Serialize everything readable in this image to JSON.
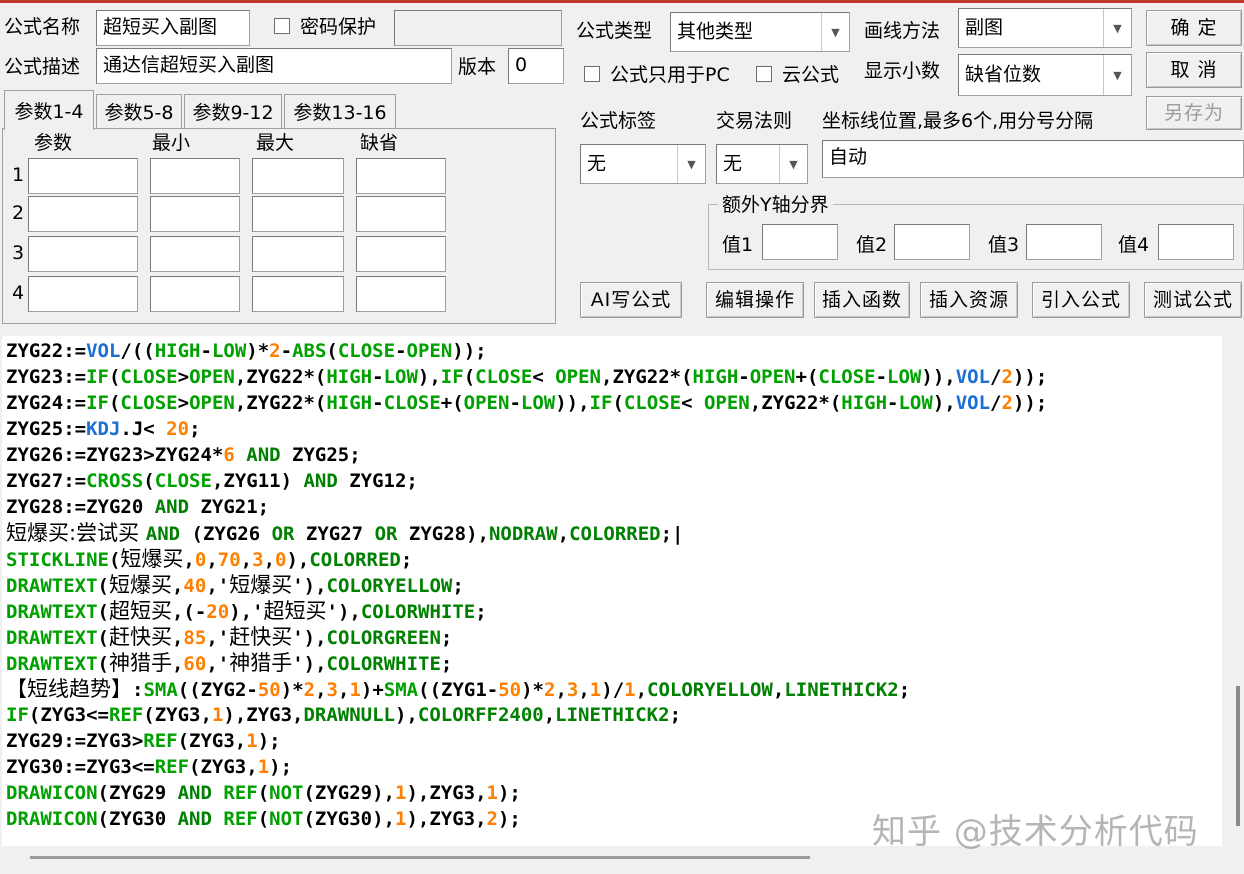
{
  "form": {
    "name_label": "公式名称",
    "name_value": "超短买入副图",
    "password_label": "密码保护",
    "password_value": "",
    "desc_label": "公式描述",
    "desc_value": "通达信超短买入副图",
    "version_label": "版本",
    "version_value": "0",
    "type_label": "公式类型",
    "type_value": "其他类型",
    "draw_label": "画线方法",
    "draw_value": "副图",
    "pc_only_label": "公式只用于PC",
    "cloud_label": "云公式",
    "decimals_label": "显示小数",
    "decimals_value": "缺省位数",
    "tag_label": "公式标签",
    "tag_value": "无",
    "rule_label": "交易法则",
    "rule_value": "无",
    "coord_label": "坐标线位置,最多6个,用分号分隔",
    "coord_value": "自动",
    "yaxis_group": "额外Y轴分界",
    "y1": "值1",
    "y2": "值2",
    "y3": "值3",
    "y4": "值4"
  },
  "buttons": {
    "ok": "确 定",
    "cancel": "取 消",
    "save_as": "另存为",
    "ai": "AI写公式",
    "edit": "编辑操作",
    "insert_func": "插入函数",
    "insert_res": "插入资源",
    "import": "引入公式",
    "test": "测试公式"
  },
  "tabs": [
    "参数1-4",
    "参数5-8",
    "参数9-12",
    "参数13-16"
  ],
  "params": {
    "headers": [
      "参数",
      "最小",
      "最大",
      "缺省"
    ],
    "rows": [
      "1",
      "2",
      "3",
      "4"
    ]
  },
  "code": [
    [
      [
        "t-def",
        "ZYG22:="
      ],
      [
        "t-var",
        "VOL"
      ],
      [
        "t-op",
        "/(("
      ],
      [
        "t-func",
        "HIGH"
      ],
      [
        "t-op",
        "-"
      ],
      [
        "t-func",
        "LOW"
      ],
      [
        "t-op",
        ")*"
      ],
      [
        "t-num",
        "2"
      ],
      [
        "t-op",
        "-"
      ],
      [
        "t-func",
        "ABS"
      ],
      [
        "t-op",
        "("
      ],
      [
        "t-func",
        "CLOSE"
      ],
      [
        "t-op",
        "-"
      ],
      [
        "t-func",
        "OPEN"
      ],
      [
        "t-op",
        "));"
      ]
    ],
    [
      [
        "t-def",
        "ZYG23:="
      ],
      [
        "t-func",
        "IF"
      ],
      [
        "t-op",
        "("
      ],
      [
        "t-func",
        "CLOSE"
      ],
      [
        "t-op",
        ">"
      ],
      [
        "t-func",
        "OPEN"
      ],
      [
        "t-op",
        ",ZYG22*("
      ],
      [
        "t-func",
        "HIGH"
      ],
      [
        "t-op",
        "-"
      ],
      [
        "t-func",
        "LOW"
      ],
      [
        "t-op",
        "),"
      ],
      [
        "t-func",
        "IF"
      ],
      [
        "t-op",
        "("
      ],
      [
        "t-func",
        "CLOSE"
      ],
      [
        "t-op",
        "< "
      ],
      [
        "t-func",
        "OPEN"
      ],
      [
        "t-op",
        ",ZYG22*("
      ],
      [
        "t-func",
        "HIGH"
      ],
      [
        "t-op",
        "-"
      ],
      [
        "t-func",
        "OPEN"
      ],
      [
        "t-op",
        "+("
      ],
      [
        "t-func",
        "CLOSE"
      ],
      [
        "t-op",
        "-"
      ],
      [
        "t-func",
        "LOW"
      ],
      [
        "t-op",
        ")),"
      ],
      [
        "t-var",
        "VOL"
      ],
      [
        "t-op",
        "/"
      ],
      [
        "t-num",
        "2"
      ],
      [
        "t-op",
        "));"
      ]
    ],
    [
      [
        "t-def",
        "ZYG24:="
      ],
      [
        "t-func",
        "IF"
      ],
      [
        "t-op",
        "("
      ],
      [
        "t-func",
        "CLOSE"
      ],
      [
        "t-op",
        ">"
      ],
      [
        "t-func",
        "OPEN"
      ],
      [
        "t-op",
        ",ZYG22*("
      ],
      [
        "t-func",
        "HIGH"
      ],
      [
        "t-op",
        "-"
      ],
      [
        "t-func",
        "CLOSE"
      ],
      [
        "t-op",
        "+("
      ],
      [
        "t-func",
        "OPEN"
      ],
      [
        "t-op",
        "-"
      ],
      [
        "t-func",
        "LOW"
      ],
      [
        "t-op",
        ")),"
      ],
      [
        "t-func",
        "IF"
      ],
      [
        "t-op",
        "("
      ],
      [
        "t-func",
        "CLOSE"
      ],
      [
        "t-op",
        "< "
      ],
      [
        "t-func",
        "OPEN"
      ],
      [
        "t-op",
        ",ZYG22*("
      ],
      [
        "t-func",
        "HIGH"
      ],
      [
        "t-op",
        "-"
      ],
      [
        "t-func",
        "LOW"
      ],
      [
        "t-op",
        "),"
      ],
      [
        "t-var",
        "VOL"
      ],
      [
        "t-op",
        "/"
      ],
      [
        "t-num",
        "2"
      ],
      [
        "t-op",
        "));"
      ]
    ],
    [
      [
        "t-def",
        "ZYG25:="
      ],
      [
        "t-var",
        "KDJ"
      ],
      [
        "t-op",
        ".J< "
      ],
      [
        "t-num",
        "20"
      ],
      [
        "t-op",
        ";"
      ]
    ],
    [
      [
        "t-def",
        "ZYG26:=ZYG23>ZYG24*"
      ],
      [
        "t-num",
        "6"
      ],
      [
        "t-op",
        " "
      ],
      [
        "t-kw",
        "AND"
      ],
      [
        "t-op",
        " ZYG25;"
      ]
    ],
    [
      [
        "t-def",
        "ZYG27:="
      ],
      [
        "t-func",
        "CROSS"
      ],
      [
        "t-op",
        "("
      ],
      [
        "t-func",
        "CLOSE"
      ],
      [
        "t-op",
        ",ZYG11) "
      ],
      [
        "t-kw",
        "AND"
      ],
      [
        "t-op",
        " ZYG12;"
      ]
    ],
    [
      [
        "t-def",
        "ZYG28:=ZYG20 "
      ],
      [
        "t-kw",
        "AND"
      ],
      [
        "t-op",
        " ZYG21;"
      ]
    ],
    [
      [
        "cn",
        "短爆买:尝试买 "
      ],
      [
        "t-kw",
        "AND"
      ],
      [
        "t-op",
        " (ZYG26 "
      ],
      [
        "t-kw",
        "OR"
      ],
      [
        "t-op",
        " ZYG27 "
      ],
      [
        "t-kw",
        "OR"
      ],
      [
        "t-op",
        " ZYG28),"
      ],
      [
        "t-kw",
        "NODRAW"
      ],
      [
        "t-op",
        ","
      ],
      [
        "t-kw",
        "COLORRED"
      ],
      [
        "t-op",
        ";|"
      ]
    ],
    [
      [
        "t-func",
        "STICKLINE"
      ],
      [
        "t-op",
        "("
      ],
      [
        "cn",
        "短爆买"
      ],
      [
        "t-op",
        ","
      ],
      [
        "t-num",
        "0"
      ],
      [
        "t-op",
        ","
      ],
      [
        "t-num",
        "70"
      ],
      [
        "t-op",
        ","
      ],
      [
        "t-num",
        "3"
      ],
      [
        "t-op",
        ","
      ],
      [
        "t-num",
        "0"
      ],
      [
        "t-op",
        "),"
      ],
      [
        "t-kw",
        "COLORRED"
      ],
      [
        "t-op",
        ";"
      ]
    ],
    [
      [
        "t-func",
        "DRAWTEXT"
      ],
      [
        "t-op",
        "("
      ],
      [
        "cn",
        "短爆买"
      ],
      [
        "t-op",
        ","
      ],
      [
        "t-num",
        "40"
      ],
      [
        "t-op",
        ",'"
      ],
      [
        "cn",
        "短爆买"
      ],
      [
        "t-op",
        "'),"
      ],
      [
        "t-kw",
        "COLORYELLOW"
      ],
      [
        "t-op",
        ";"
      ]
    ],
    [
      [
        "t-func",
        "DRAWTEXT"
      ],
      [
        "t-op",
        "("
      ],
      [
        "cn",
        "超短买"
      ],
      [
        "t-op",
        ",(-"
      ],
      [
        "t-num",
        "20"
      ],
      [
        "t-op",
        "),'"
      ],
      [
        "cn",
        "超短买"
      ],
      [
        "t-op",
        "'),"
      ],
      [
        "t-kw",
        "COLORWHITE"
      ],
      [
        "t-op",
        ";"
      ]
    ],
    [
      [
        "t-func",
        "DRAWTEXT"
      ],
      [
        "t-op",
        "("
      ],
      [
        "cn",
        "赶快买"
      ],
      [
        "t-op",
        ","
      ],
      [
        "t-num",
        "85"
      ],
      [
        "t-op",
        ",'"
      ],
      [
        "cn",
        "赶快买"
      ],
      [
        "t-op",
        "'),"
      ],
      [
        "t-kw",
        "COLORGREEN"
      ],
      [
        "t-op",
        ";"
      ]
    ],
    [
      [
        "t-func",
        "DRAWTEXT"
      ],
      [
        "t-op",
        "("
      ],
      [
        "cn",
        "神猎手"
      ],
      [
        "t-op",
        ","
      ],
      [
        "t-num",
        "60"
      ],
      [
        "t-op",
        ",'"
      ],
      [
        "cn",
        "神猎手"
      ],
      [
        "t-op",
        "'),"
      ],
      [
        "t-kw",
        "COLORWHITE"
      ],
      [
        "t-op",
        ";"
      ]
    ],
    [
      [
        "cn",
        "【短线趋势】"
      ],
      [
        "t-op",
        ":"
      ],
      [
        "t-func",
        "SMA"
      ],
      [
        "t-op",
        "((ZYG2-"
      ],
      [
        "t-num",
        "50"
      ],
      [
        "t-op",
        ")*"
      ],
      [
        "t-num",
        "2"
      ],
      [
        "t-op",
        ","
      ],
      [
        "t-num",
        "3"
      ],
      [
        "t-op",
        ","
      ],
      [
        "t-num",
        "1"
      ],
      [
        "t-op",
        ")+"
      ],
      [
        "t-func",
        "SMA"
      ],
      [
        "t-op",
        "((ZYG1-"
      ],
      [
        "t-num",
        "50"
      ],
      [
        "t-op",
        ")*"
      ],
      [
        "t-num",
        "2"
      ],
      [
        "t-op",
        ","
      ],
      [
        "t-num",
        "3"
      ],
      [
        "t-op",
        ","
      ],
      [
        "t-num",
        "1"
      ],
      [
        "t-op",
        ")/"
      ],
      [
        "t-num",
        "1"
      ],
      [
        "t-op",
        ","
      ],
      [
        "t-kw",
        "COLORYELLOW"
      ],
      [
        "t-op",
        ","
      ],
      [
        "t-kw",
        "LINETHICK2"
      ],
      [
        "t-op",
        ";"
      ]
    ],
    [
      [
        "t-func",
        "IF"
      ],
      [
        "t-op",
        "(ZYG3<="
      ],
      [
        "t-func",
        "REF"
      ],
      [
        "t-op",
        "(ZYG3,"
      ],
      [
        "t-num",
        "1"
      ],
      [
        "t-op",
        "),ZYG3,"
      ],
      [
        "t-kw",
        "DRAWNULL"
      ],
      [
        "t-op",
        "),"
      ],
      [
        "t-kw",
        "COLORFF2400"
      ],
      [
        "t-op",
        ","
      ],
      [
        "t-kw",
        "LINETHICK2"
      ],
      [
        "t-op",
        ";"
      ]
    ],
    [
      [
        "t-def",
        "ZYG29:=ZYG3>"
      ],
      [
        "t-func",
        "REF"
      ],
      [
        "t-op",
        "(ZYG3,"
      ],
      [
        "t-num",
        "1"
      ],
      [
        "t-op",
        ");"
      ]
    ],
    [
      [
        "t-def",
        "ZYG30:=ZYG3<="
      ],
      [
        "t-func",
        "REF"
      ],
      [
        "t-op",
        "(ZYG3,"
      ],
      [
        "t-num",
        "1"
      ],
      [
        "t-op",
        ");"
      ]
    ],
    [
      [
        "t-func",
        "DRAWICON"
      ],
      [
        "t-op",
        "(ZYG29 "
      ],
      [
        "t-kw",
        "AND"
      ],
      [
        "t-op",
        " "
      ],
      [
        "t-func",
        "REF"
      ],
      [
        "t-op",
        "("
      ],
      [
        "t-func",
        "NOT"
      ],
      [
        "t-op",
        "(ZYG29),"
      ],
      [
        "t-num",
        "1"
      ],
      [
        "t-op",
        "),ZYG3,"
      ],
      [
        "t-num",
        "1"
      ],
      [
        "t-op",
        ");"
      ]
    ],
    [
      [
        "t-func",
        "DRAWICON"
      ],
      [
        "t-op",
        "(ZYG30 "
      ],
      [
        "t-kw",
        "AND"
      ],
      [
        "t-op",
        " "
      ],
      [
        "t-func",
        "REF"
      ],
      [
        "t-op",
        "("
      ],
      [
        "t-func",
        "NOT"
      ],
      [
        "t-op",
        "(ZYG30),"
      ],
      [
        "t-num",
        "1"
      ],
      [
        "t-op",
        "),ZYG3,"
      ],
      [
        "t-num",
        "2"
      ],
      [
        "t-op",
        ");"
      ]
    ]
  ],
  "watermark": "知乎 @技术分析代码"
}
